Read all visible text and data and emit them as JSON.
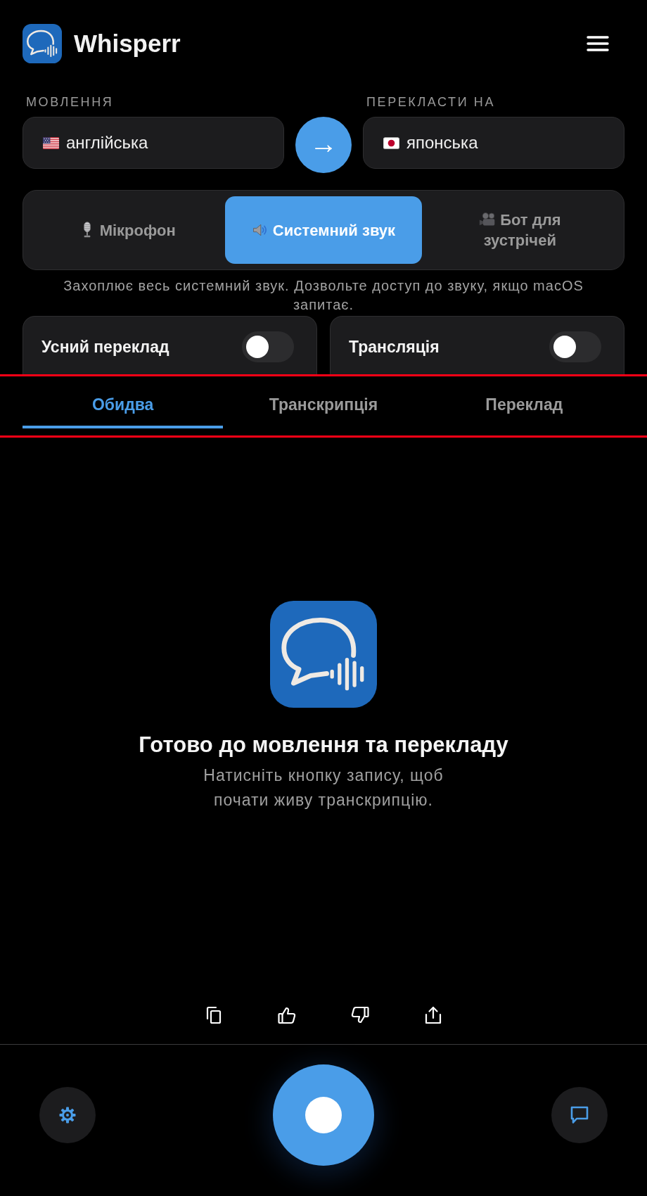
{
  "header": {
    "title": "Whisperr"
  },
  "languages": {
    "source": {
      "label": "МОВЛЕННЯ",
      "value": "англійська"
    },
    "swap": "→",
    "target": {
      "label": "ПЕРЕКЛАСТИ НА",
      "value": "японська"
    }
  },
  "source_modes": [
    {
      "kind": "microphone",
      "label": "Мікрофон",
      "selected": false
    },
    {
      "kind": "system",
      "label": "Системний звук",
      "selected": true
    },
    {
      "kind": "bot",
      "label": "Бот для зустрічей",
      "selected": false
    }
  ],
  "source_hint": "Захоплює весь системний звук. Дозвольте доступ до звуку, якщо macOS запитає.",
  "toggles": [
    {
      "label": "Усний переклад",
      "on": false
    },
    {
      "label": "Трансляція",
      "on": false
    }
  ],
  "tabs": [
    {
      "label": "Обидва",
      "selected": true
    },
    {
      "label": "Транскрипція",
      "selected": false
    },
    {
      "label": "Переклад",
      "selected": false
    }
  ],
  "empty_state": {
    "title": "Готово до мовлення та перекладу",
    "subtitle": "Натисніть кнопку запису, щоб почати живу транскрипцію."
  }
}
